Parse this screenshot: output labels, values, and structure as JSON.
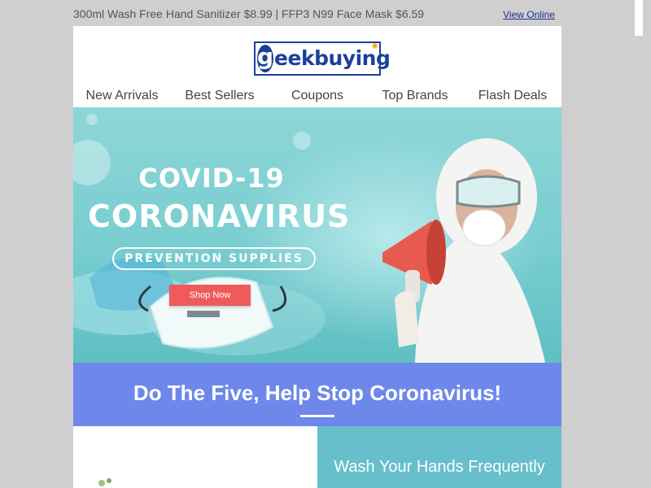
{
  "preheader": {
    "promo_text": "300ml Wash Free Hand Sanitizer $8.99 | FFP3 N99 Face Mask $6.59",
    "view_online": "View Online"
  },
  "logo": {
    "letter": "g",
    "text": "eekbuying"
  },
  "nav": {
    "items": [
      {
        "label": "New Arrivals"
      },
      {
        "label": "Best Sellers"
      },
      {
        "label": "Coupons"
      },
      {
        "label": "Top Brands"
      },
      {
        "label": "Flash Deals"
      }
    ]
  },
  "hero": {
    "title_line1": "COVID-19",
    "title_line2": "CORONAVIRUS",
    "subtitle": "PREVENTION SUPPLIES",
    "button_label": "Shop Now"
  },
  "section": {
    "title": "Do The Five, Help Stop Coronavirus!"
  },
  "tips": [
    {
      "label": "Wash Your Hands Frequently"
    }
  ],
  "colors": {
    "brand_blue": "#1d3f9b",
    "hero_teal": "#78cdd0",
    "section_blue": "#6d88ea",
    "tip_teal": "#66bfcb",
    "shop_button": "#ef5b5b",
    "megaphone_red": "#e85a4f"
  }
}
